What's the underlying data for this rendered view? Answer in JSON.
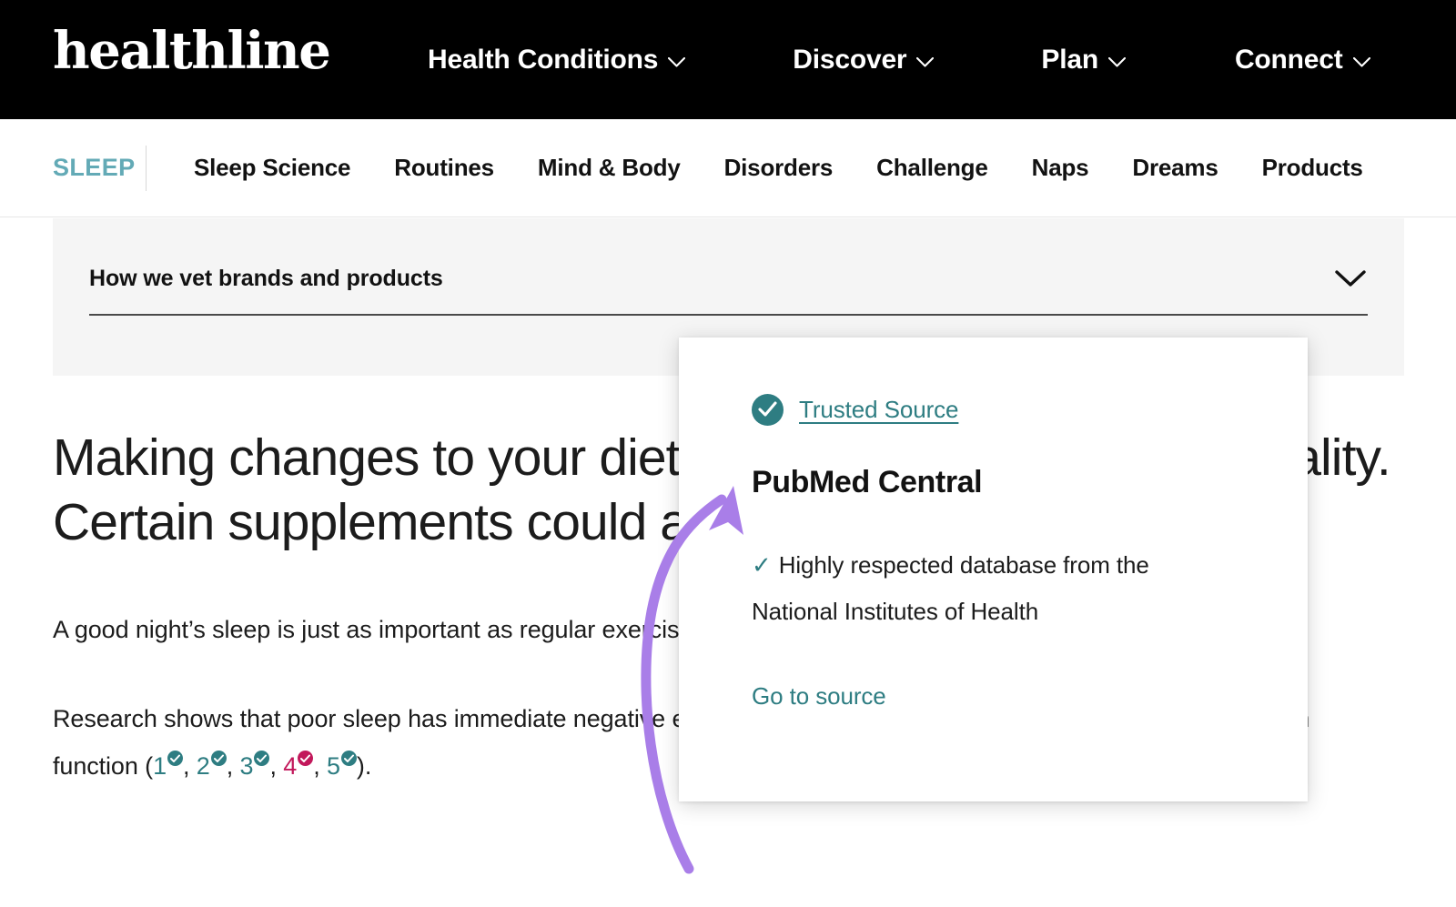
{
  "site": {
    "logo_text": "healthline",
    "logo_color": "#ffffff",
    "masthead_bg": "#000000"
  },
  "masthead_nav": {
    "items": [
      {
        "label": "Health Conditions",
        "icon": "chevron-down-icon"
      },
      {
        "label": "Discover",
        "icon": "chevron-down-icon"
      },
      {
        "label": "Plan",
        "icon": "chevron-down-icon"
      },
      {
        "label": "Connect",
        "icon": "chevron-down-icon"
      }
    ]
  },
  "subnav": {
    "section_label": "SLEEP",
    "section_color": "#63aab6",
    "items": [
      {
        "label": "Sleep Science"
      },
      {
        "label": "Routines"
      },
      {
        "label": "Mind & Body"
      },
      {
        "label": "Disorders"
      },
      {
        "label": "Challenge"
      },
      {
        "label": "Naps"
      },
      {
        "label": "Dreams"
      },
      {
        "label": "Products"
      }
    ]
  },
  "vet_panel": {
    "title": "How we vet brands and products",
    "expand_icon": "chevron-down-icon",
    "background": "#f5f5f5"
  },
  "article": {
    "headline": "Making changes to your diet may help improve sleep quality. Certain supplements could also be beneficial.",
    "paragraph_1": "A good night’s sleep is just as important as regular exercise and a healthy diet.",
    "paragraph_2_prefix": "Research shows that poor sleep has immediate negative effects on your hormones, exercise performance, and brain function (",
    "paragraph_2_suffix": ").",
    "citations": [
      {
        "number": "1",
        "state": "default",
        "color": "#2e7d82",
        "separator": ", "
      },
      {
        "number": "2",
        "state": "default",
        "color": "#2e7d82",
        "separator": ", "
      },
      {
        "number": "3",
        "state": "default",
        "color": "#2e7d82",
        "separator": ", "
      },
      {
        "number": "4",
        "state": "active",
        "color": "#c2185b",
        "separator": ", "
      },
      {
        "number": "5",
        "state": "default",
        "color": "#2e7d82",
        "separator": ""
      }
    ]
  },
  "source_card": {
    "trusted_badge_icon": "check-circle-icon",
    "trusted_label": "Trusted Source",
    "source_name": "PubMed Central",
    "bullet_icon": "check-icon",
    "bullet_text": "Highly respected database from the National Institutes of Health",
    "go_to_source_label": "Go to source",
    "accent_color": "#2e7d82"
  },
  "annotation": {
    "arrow_color": "#a97ee8",
    "arrow_description": "curved arrow from citation 4 to the source card"
  }
}
